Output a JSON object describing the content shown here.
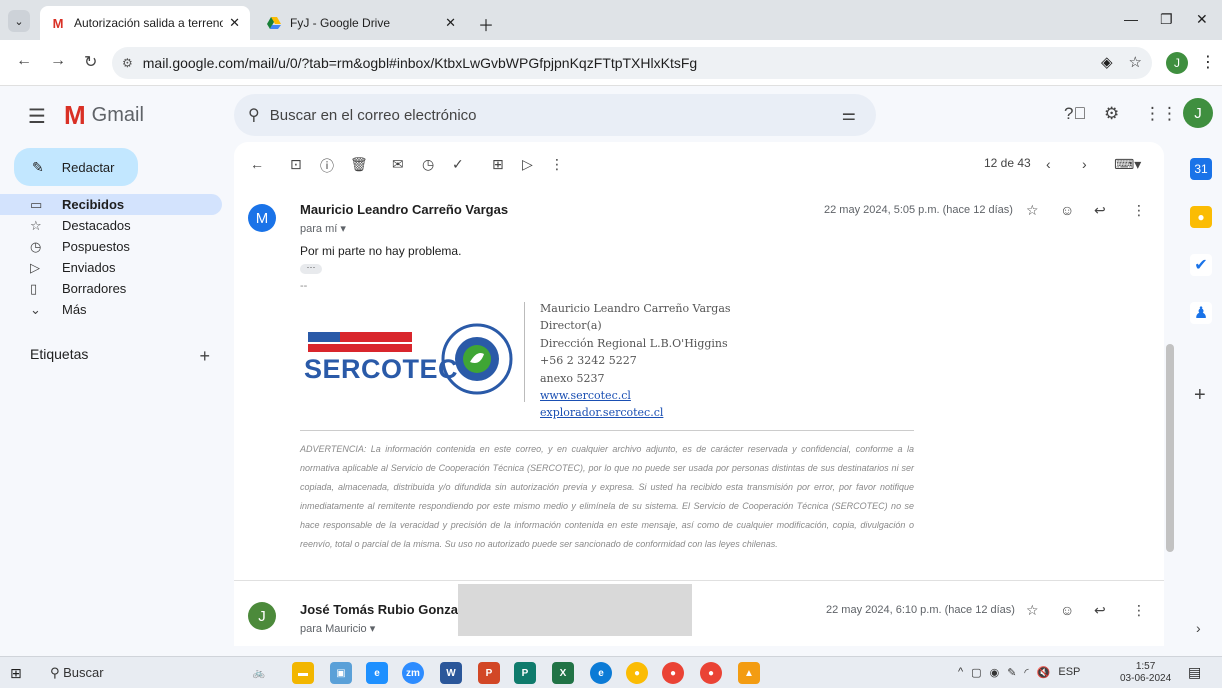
{
  "browser": {
    "tabs": [
      {
        "title": "Autorización salida a terreno - j",
        "favicon": "gmail-icon",
        "active": true
      },
      {
        "title": "FyJ - Google Drive",
        "favicon": "drive-icon",
        "active": false
      }
    ],
    "url": "mail.google.com/mail/u/0/?tab=rm&ogbl#inbox/KtbxLwGvbWPGfpjpnKqzFTtpTXHlxKtsFg",
    "profile_initial": "J"
  },
  "gmail": {
    "logo_text": "Gmail",
    "search_placeholder": "Buscar en el correo electrónico",
    "account_initial": "J",
    "compose_label": "Redactar",
    "nav": [
      {
        "label": "Recibidos",
        "icon": "inbox-icon",
        "active": true
      },
      {
        "label": "Destacados",
        "icon": "star-icon",
        "active": false
      },
      {
        "label": "Pospuestos",
        "icon": "clock-icon",
        "active": false
      },
      {
        "label": "Enviados",
        "icon": "send-icon",
        "active": false
      },
      {
        "label": "Borradores",
        "icon": "draft-icon",
        "active": false
      },
      {
        "label": "Más",
        "icon": "chevron-down-icon",
        "active": false
      }
    ],
    "labels_header": "Etiquetas",
    "pagination": "12 de 43"
  },
  "message1": {
    "avatar_initial": "M",
    "avatar_color": "#1a73e8",
    "sender": "Mauricio Leandro Carreño Vargas",
    "to": "para mí",
    "date": "22 may 2024, 5:05 p.m. (hace 12 días)",
    "body": "Por mi parte no hay problema.",
    "sig_dash": "--",
    "logo_text": "SERCOTEC",
    "signature": {
      "name": "Mauricio Leandro Carreño Vargas",
      "role": "Director(a)",
      "office": "Dirección Regional L.B.O'Higgins",
      "phone": "+56 2 3242 5227",
      "ext": "anexo 5237",
      "web1": "www.sercotec.cl",
      "web2": "explorador.sercotec.cl"
    },
    "warning": "ADVERTENCIA: La información contenida en este correo, y en cualquier archivo adjunto, es de carácter reservada y confidencial, conforme a la normativa aplicable al Servicio de Cooperación Técnica (SERCOTEC), por lo que no puede ser usada por personas distintas de sus destinatarios ni ser copiada, almacenada, distribuida y/o difundida sin autorización previa y expresa. Si usted ha recibido esta transmisión por error, por favor notifique inmediatamente al remitente respondiendo por este mismo medio y elimínela de su sistema. El Servicio de Cooperación Técnica (SERCOTEC) no se hace responsable de la veracidad y precisión de la información contenida en este mensaje, así como de cualquier modificación, copia, divulgación o reenvío, total o parcial de la misma. Su uso no autorizado puede ser sancionado de conformidad con las leyes chilenas."
  },
  "message2": {
    "avatar_initial": "J",
    "sender": "José Tomás Rubio Gonzale",
    "to": "para Mauricio",
    "date": "22 may 2024, 6:10 p.m. (hace 12 días)"
  },
  "taskbar": {
    "search_label": "Buscar",
    "lang": "ESP",
    "time": "1:57",
    "date": "03-06-2024"
  }
}
